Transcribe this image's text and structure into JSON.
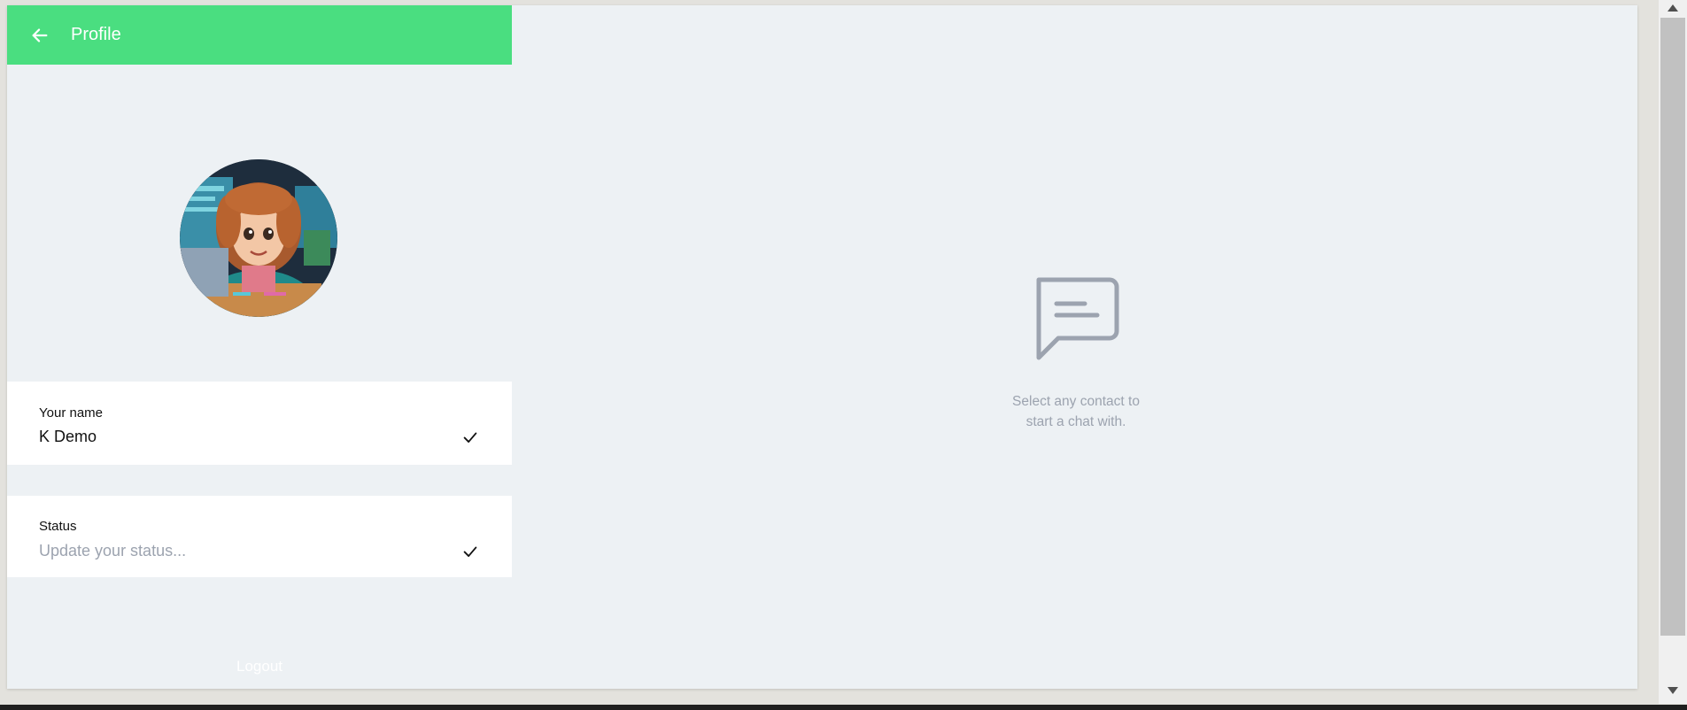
{
  "header": {
    "title": "Profile",
    "back_icon": "arrow-left-icon",
    "background_color": "#4ade80"
  },
  "profile": {
    "avatar_description": "cartoon avatar",
    "name_label": "Your name",
    "name_value": "K Demo",
    "status_label": "Status",
    "status_placeholder": "Update your status...",
    "status_value": ""
  },
  "logout_label": "Logout",
  "empty_state": {
    "icon": "message-square-icon",
    "line1": "Select any contact to",
    "line2": "start a chat with."
  }
}
